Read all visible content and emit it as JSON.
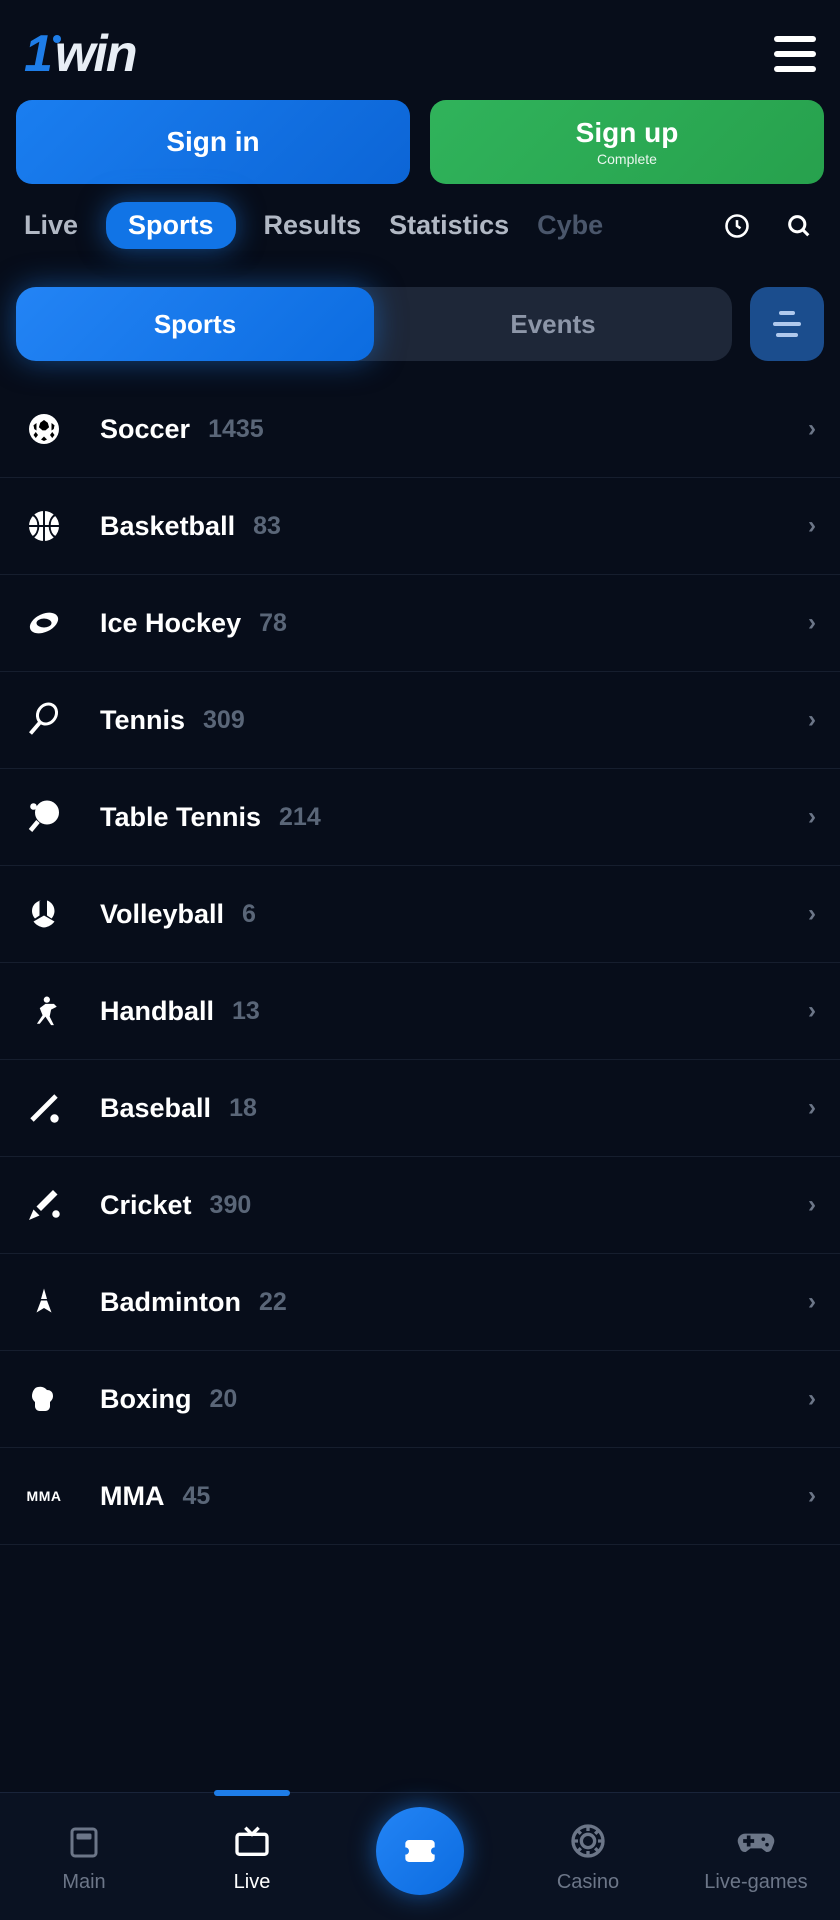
{
  "logo": {
    "part1": "1",
    "part2": "win"
  },
  "auth": {
    "signin_label": "Sign in",
    "signup_label": "Sign up",
    "signup_sub": "Complete"
  },
  "nav": {
    "items": [
      {
        "label": "Live",
        "active": false
      },
      {
        "label": "Sports",
        "active": true
      },
      {
        "label": "Results",
        "active": false
      },
      {
        "label": "Statistics",
        "active": false
      },
      {
        "label": "Cybe",
        "active": false,
        "faded": true
      }
    ]
  },
  "toggle": {
    "sports_label": "Sports",
    "events_label": "Events"
  },
  "sports": [
    {
      "name": "Soccer",
      "count": "1435",
      "icon": "soccer"
    },
    {
      "name": "Basketball",
      "count": "83",
      "icon": "basketball"
    },
    {
      "name": "Ice Hockey",
      "count": "78",
      "icon": "hockey"
    },
    {
      "name": "Tennis",
      "count": "309",
      "icon": "tennis"
    },
    {
      "name": "Table Tennis",
      "count": "214",
      "icon": "tabletennis"
    },
    {
      "name": "Volleyball",
      "count": "6",
      "icon": "volleyball"
    },
    {
      "name": "Handball",
      "count": "13",
      "icon": "handball"
    },
    {
      "name": "Baseball",
      "count": "18",
      "icon": "baseball"
    },
    {
      "name": "Cricket",
      "count": "390",
      "icon": "cricket"
    },
    {
      "name": "Badminton",
      "count": "22",
      "icon": "badminton"
    },
    {
      "name": "Boxing",
      "count": "20",
      "icon": "boxing"
    },
    {
      "name": "MMA",
      "count": "45",
      "icon": "mma"
    }
  ],
  "bottomnav": {
    "main": "Main",
    "live": "Live",
    "casino": "Casino",
    "livegames": "Live-games"
  }
}
